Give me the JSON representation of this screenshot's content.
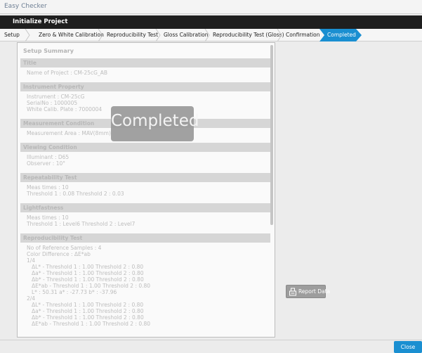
{
  "window": {
    "title": "Easy Checker"
  },
  "header": {
    "title": "Initialize Project"
  },
  "steps": [
    {
      "label": "Setup"
    },
    {
      "label": "Zero & White Calibration"
    },
    {
      "label": "Reproducibility Test"
    },
    {
      "label": "Gloss Calibration"
    },
    {
      "label": "Reproducibility Test (Gloss)"
    },
    {
      "label": "Confirmation"
    },
    {
      "label": "Completed",
      "active": true
    }
  ],
  "summary": {
    "title": "Setup Summary",
    "sections": [
      {
        "heading": "Title",
        "lines": [
          "Name of Project : CM-25cG_AB"
        ]
      },
      {
        "heading": "Instrument Property",
        "lines": [
          "Instrument : CM-25cG",
          "SerialNo : 1000005",
          "White Calib. Plate : 7000004"
        ]
      },
      {
        "heading": "Measurement Condition",
        "lines": [
          "Measurement Area : MAV(8mm)"
        ]
      },
      {
        "heading": "Viewing Condition",
        "lines": [
          "Illuminant : D65",
          "Observer : 10°"
        ]
      },
      {
        "heading": "Repeatability Test",
        "lines": [
          "Meas times : 10",
          "Threshold 1 : 0.08  Threshold 2 : 0.03"
        ]
      },
      {
        "heading": "Lightfastness",
        "lines": [
          "Meas times : 10",
          "Threshold 1 : Level6  Threshold 2 : Level7"
        ]
      },
      {
        "heading": "Reproducibility Test",
        "lines": [
          "No of Reference Samples : 4",
          "Color Difference : ΔE*ab",
          "1/4",
          "ΔL* - Threshold 1 : 1.00  Threshold 2 : 0.80",
          "Δa* - Threshold 1 : 1.00  Threshold 2 : 0.80",
          "Δb* - Threshold 1 : 1.00  Threshold 2 : 0.80",
          "ΔE*ab - Threshold 1 : 1.00  Threshold 2 : 0.80",
          "L* : 50.31  a* : -27.73  b* : -37.96",
          "2/4",
          "ΔL* - Threshold 1 : 1.00  Threshold 2 : 0.80",
          "Δa* - Threshold 1 : 1.00  Threshold 2 : 0.80",
          "Δb* - Threshold 1 : 1.00  Threshold 2 : 0.80",
          "ΔE*ab - Threshold 1 : 1.00  Threshold 2 : 0.80"
        ]
      }
    ]
  },
  "overlay": {
    "text": "Completed"
  },
  "report_button": {
    "label": "Report Data",
    "icon": "report-icon"
  },
  "close_button": {
    "label": "Close"
  },
  "colors": {
    "accent": "#1a8fd1",
    "header_bg": "#1f1f1f"
  }
}
